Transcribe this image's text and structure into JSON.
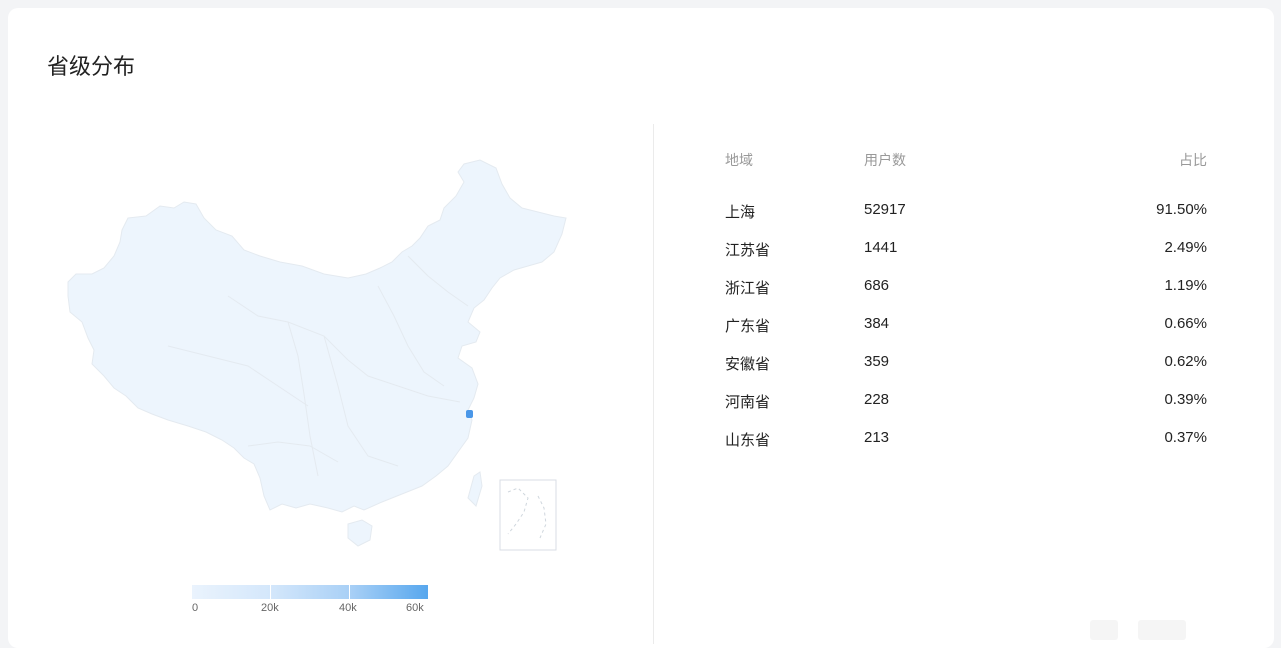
{
  "card": {
    "title": "省级分布"
  },
  "table": {
    "headers": {
      "region": "地域",
      "users": "用户数",
      "ratio": "占比"
    },
    "rows": [
      {
        "region": "上海",
        "users": "52917",
        "ratio": "91.50%"
      },
      {
        "region": "江苏省",
        "users": "1441",
        "ratio": "2.49%"
      },
      {
        "region": "浙江省",
        "users": "686",
        "ratio": "1.19%"
      },
      {
        "region": "广东省",
        "users": "384",
        "ratio": "0.66%"
      },
      {
        "region": "安徽省",
        "users": "359",
        "ratio": "0.62%"
      },
      {
        "region": "河南省",
        "users": "228",
        "ratio": "0.39%"
      },
      {
        "region": "山东省",
        "users": "213",
        "ratio": "0.37%"
      }
    ]
  },
  "legend": {
    "ticks": [
      "0",
      "20k",
      "40k",
      "60k"
    ],
    "colors": [
      "#eaf3fd",
      "#b9d9f8",
      "#8ac0f3",
      "#57a7ee"
    ]
  },
  "colors": {
    "map_fill": "#edf5fd",
    "map_border": "#e4eaf0",
    "highlight": "#4a97e8"
  }
}
